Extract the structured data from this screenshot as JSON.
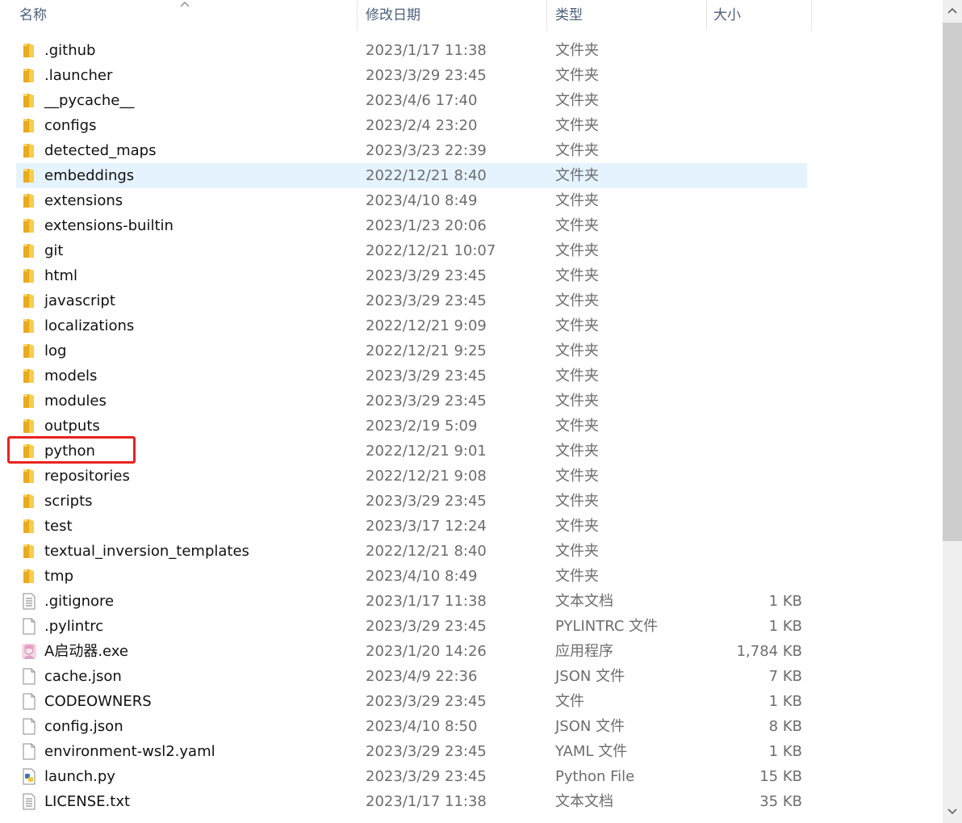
{
  "header": {
    "name": "名称",
    "date": "修改日期",
    "type": "类型",
    "size": "大小"
  },
  "rows": [
    {
      "name": ".github",
      "date": "2023/1/17 11:38",
      "type": "文件夹",
      "size": "",
      "icon": "folder-icon"
    },
    {
      "name": ".launcher",
      "date": "2023/3/29 23:45",
      "type": "文件夹",
      "size": "",
      "icon": "folder-icon"
    },
    {
      "name": "__pycache__",
      "date": "2023/4/6 17:40",
      "type": "文件夹",
      "size": "",
      "icon": "folder-icon"
    },
    {
      "name": "configs",
      "date": "2023/2/4 23:20",
      "type": "文件夹",
      "size": "",
      "icon": "folder-icon"
    },
    {
      "name": "detected_maps",
      "date": "2023/3/23 22:39",
      "type": "文件夹",
      "size": "",
      "icon": "folder-icon"
    },
    {
      "name": "embeddings",
      "date": "2022/12/21 8:40",
      "type": "文件夹",
      "size": "",
      "icon": "folder-icon"
    },
    {
      "name": "extensions",
      "date": "2023/4/10 8:49",
      "type": "文件夹",
      "size": "",
      "icon": "folder-icon"
    },
    {
      "name": "extensions-builtin",
      "date": "2023/1/23 20:06",
      "type": "文件夹",
      "size": "",
      "icon": "folder-icon"
    },
    {
      "name": "git",
      "date": "2022/12/21 10:07",
      "type": "文件夹",
      "size": "",
      "icon": "folder-icon"
    },
    {
      "name": "html",
      "date": "2023/3/29 23:45",
      "type": "文件夹",
      "size": "",
      "icon": "folder-icon"
    },
    {
      "name": "javascript",
      "date": "2023/3/29 23:45",
      "type": "文件夹",
      "size": "",
      "icon": "folder-icon"
    },
    {
      "name": "localizations",
      "date": "2022/12/21 9:09",
      "type": "文件夹",
      "size": "",
      "icon": "folder-icon"
    },
    {
      "name": "log",
      "date": "2022/12/21 9:25",
      "type": "文件夹",
      "size": "",
      "icon": "folder-icon"
    },
    {
      "name": "models",
      "date": "2023/3/29 23:45",
      "type": "文件夹",
      "size": "",
      "icon": "folder-icon"
    },
    {
      "name": "modules",
      "date": "2023/3/29 23:45",
      "type": "文件夹",
      "size": "",
      "icon": "folder-icon"
    },
    {
      "name": "outputs",
      "date": "2023/2/19 5:09",
      "type": "文件夹",
      "size": "",
      "icon": "folder-icon"
    },
    {
      "name": "python",
      "date": "2022/12/21 9:01",
      "type": "文件夹",
      "size": "",
      "icon": "folder-icon"
    },
    {
      "name": "repositories",
      "date": "2022/12/21 9:08",
      "type": "文件夹",
      "size": "",
      "icon": "folder-icon"
    },
    {
      "name": "scripts",
      "date": "2023/3/29 23:45",
      "type": "文件夹",
      "size": "",
      "icon": "folder-icon"
    },
    {
      "name": "test",
      "date": "2023/3/17 12:24",
      "type": "文件夹",
      "size": "",
      "icon": "folder-icon"
    },
    {
      "name": "textual_inversion_templates",
      "date": "2022/12/21 8:40",
      "type": "文件夹",
      "size": "",
      "icon": "folder-icon"
    },
    {
      "name": "tmp",
      "date": "2023/4/10 8:49",
      "type": "文件夹",
      "size": "",
      "icon": "folder-icon"
    },
    {
      "name": ".gitignore",
      "date": "2023/1/17 11:38",
      "type": "文本文档",
      "size": "1 KB",
      "icon": "text-file-icon"
    },
    {
      "name": ".pylintrc",
      "date": "2023/3/29 23:45",
      "type": "PYLINTRC 文件",
      "size": "1 KB",
      "icon": "file-icon"
    },
    {
      "name": "A启动器.exe",
      "date": "2023/1/20 14:26",
      "type": "应用程序",
      "size": "1,784 KB",
      "icon": "app-icon"
    },
    {
      "name": "cache.json",
      "date": "2023/4/9 22:36",
      "type": "JSON 文件",
      "size": "7 KB",
      "icon": "file-icon"
    },
    {
      "name": "CODEOWNERS",
      "date": "2023/3/29 23:45",
      "type": "文件",
      "size": "1 KB",
      "icon": "file-icon"
    },
    {
      "name": "config.json",
      "date": "2023/4/10 8:50",
      "type": "JSON 文件",
      "size": "8 KB",
      "icon": "file-icon"
    },
    {
      "name": "environment-wsl2.yaml",
      "date": "2023/3/29 23:45",
      "type": "YAML 文件",
      "size": "1 KB",
      "icon": "file-icon"
    },
    {
      "name": "launch.py",
      "date": "2023/3/29 23:45",
      "type": "Python File",
      "size": "15 KB",
      "icon": "python-file-icon"
    },
    {
      "name": "LICENSE.txt",
      "date": "2023/1/17 11:38",
      "type": "文本文档",
      "size": "35 KB",
      "icon": "text-file-icon"
    }
  ],
  "hover_row": "embeddings",
  "highlighted_row": "python",
  "colors": {
    "hover_bg": "#e5f3ff",
    "highlight_border": "#e8231f",
    "folder": "#f3c244"
  }
}
